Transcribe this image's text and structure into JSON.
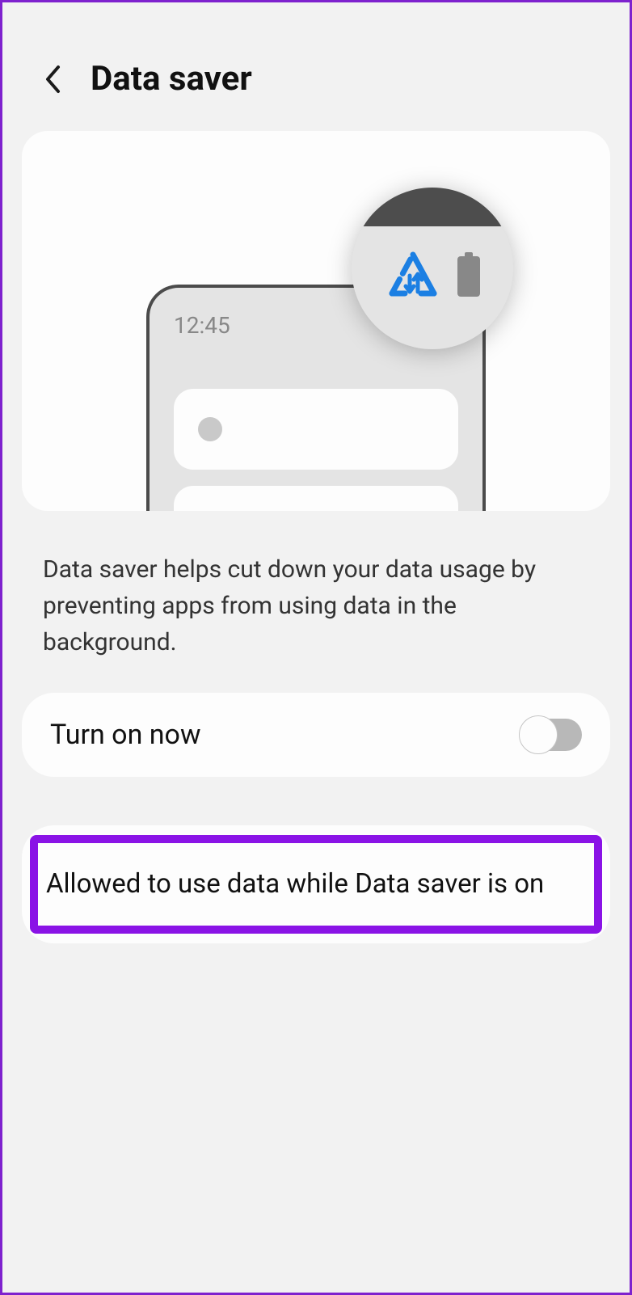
{
  "header": {
    "title": "Data saver"
  },
  "illustration": {
    "clock_time": "12:45"
  },
  "description": "Data saver helps cut down your data usage by preventing apps from using data in the background.",
  "toggle": {
    "label": "Turn on now",
    "state": false
  },
  "allowed_row": {
    "label": "Allowed to use data while Data saver is on"
  }
}
